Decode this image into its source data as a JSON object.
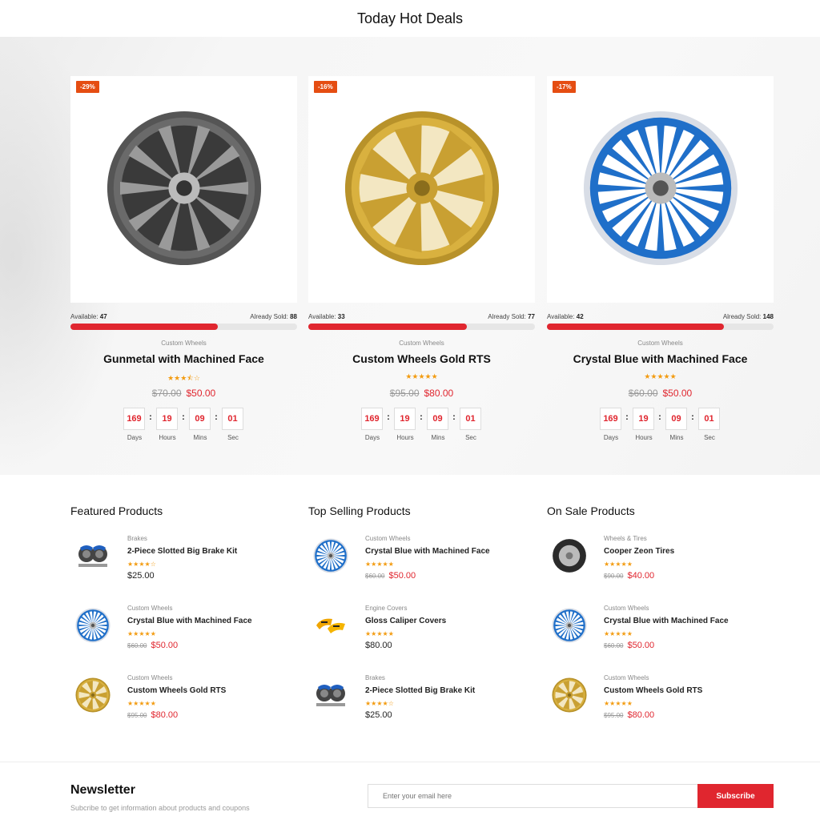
{
  "hot_deals": {
    "title": "Today Hot Deals",
    "cards": [
      {
        "discount": "-29%",
        "image": "gunmetal-wheel",
        "available_label": "Available:",
        "available": "47",
        "sold_label": "Already Sold:",
        "sold": "88",
        "sold_fraction": 0.65,
        "category": "Custom Wheels",
        "name": "Gunmetal with Machined Face",
        "stars": "★★★⯪☆",
        "old_price": "$70.00",
        "price": "$50.00",
        "timer": {
          "days": "169",
          "hours": "19",
          "mins": "09",
          "sec": "01"
        }
      },
      {
        "discount": "-16%",
        "image": "gold-wheel",
        "available_label": "Available:",
        "available": "33",
        "sold_label": "Already Sold:",
        "sold": "77",
        "sold_fraction": 0.7,
        "category": "Custom Wheels",
        "name": "Custom Wheels Gold RTS",
        "stars": "★★★★★",
        "old_price": "$95.00",
        "price": "$80.00",
        "timer": {
          "days": "169",
          "hours": "19",
          "mins": "09",
          "sec": "01"
        }
      },
      {
        "discount": "-17%",
        "image": "blue-wheel",
        "available_label": "Available:",
        "available": "42",
        "sold_label": "Already Sold:",
        "sold": "148",
        "sold_fraction": 0.78,
        "category": "Custom Wheels",
        "name": "Crystal Blue with Machined Face",
        "stars": "★★★★★",
        "old_price": "$60.00",
        "price": "$50.00",
        "timer": {
          "days": "169",
          "hours": "19",
          "mins": "09",
          "sec": "01"
        }
      }
    ],
    "timer_labels": {
      "days": "Days",
      "hours": "Hours",
      "mins": "Mins",
      "sec": "Sec"
    }
  },
  "columns": [
    {
      "title": "Featured Products",
      "items": [
        {
          "category": "Brakes",
          "name": "2-Piece Slotted Big Brake Kit",
          "stars": "★★★★☆",
          "old_price": "",
          "price": "$25.00",
          "icon": "brake-kit"
        },
        {
          "category": "Custom Wheels",
          "name": "Crystal Blue with Machined Face",
          "stars": "★★★★★",
          "old_price": "$60.00",
          "price": "$50.00",
          "icon": "blue-wheel"
        },
        {
          "category": "Custom Wheels",
          "name": "Custom Wheels Gold RTS",
          "stars": "★★★★★",
          "old_price": "$95.00",
          "price": "$80.00",
          "icon": "gold-wheel"
        }
      ]
    },
    {
      "title": "Top Selling Products",
      "items": [
        {
          "category": "Custom Wheels",
          "name": "Crystal Blue with Machined Face",
          "stars": "★★★★★",
          "old_price": "$60.00",
          "price": "$50.00",
          "icon": "blue-wheel"
        },
        {
          "category": "Engine Covers",
          "name": "Gloss Caliper Covers",
          "stars": "★★★★★",
          "old_price": "",
          "price": "$80.00",
          "icon": "caliper-covers"
        },
        {
          "category": "Brakes",
          "name": "2-Piece Slotted Big Brake Kit",
          "stars": "★★★★☆",
          "old_price": "",
          "price": "$25.00",
          "icon": "brake-kit"
        }
      ]
    },
    {
      "title": "On Sale Products",
      "items": [
        {
          "category": "Wheels & Tires",
          "name": "Cooper Zeon Tires",
          "stars": "★★★★★",
          "old_price": "$90.00",
          "price": "$40.00",
          "icon": "tire"
        },
        {
          "category": "Custom Wheels",
          "name": "Crystal Blue with Machined Face",
          "stars": "★★★★★",
          "old_price": "$60.00",
          "price": "$50.00",
          "icon": "blue-wheel"
        },
        {
          "category": "Custom Wheels",
          "name": "Custom Wheels Gold RTS",
          "stars": "★★★★★",
          "old_price": "$95.00",
          "price": "$80.00",
          "icon": "gold-wheel"
        }
      ]
    }
  ],
  "newsletter": {
    "title": "Newsletter",
    "subtitle": "Subcribe to get information about products and coupons",
    "placeholder": "Enter your email here",
    "button": "Subscribe"
  },
  "colors": {
    "accent": "#e0262f",
    "badge": "#e54d12",
    "stars": "#f39c12"
  }
}
